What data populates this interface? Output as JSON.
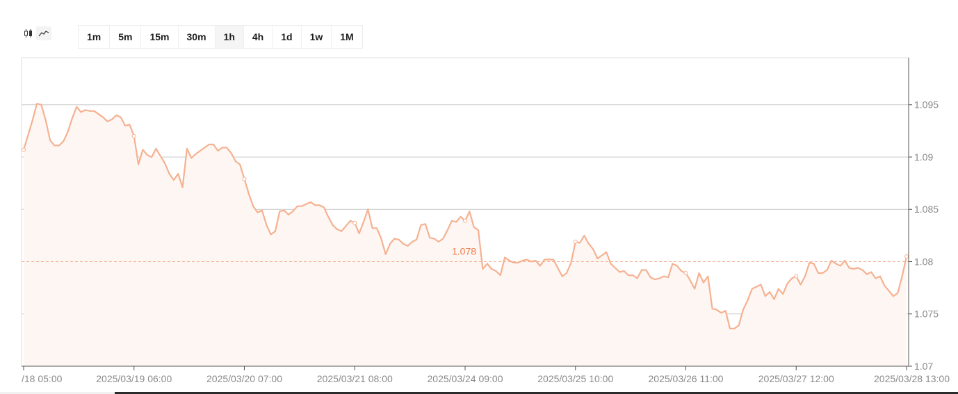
{
  "toolbar": {
    "chart_types": [
      {
        "icon": "candlestick-icon",
        "active": false
      },
      {
        "icon": "line-chart-icon",
        "active": true
      }
    ],
    "intervals": [
      "1m",
      "5m",
      "15m",
      "30m",
      "1h",
      "4h",
      "1d",
      "1w",
      "1M"
    ],
    "active_interval": "1h"
  },
  "chart_data": {
    "type": "area",
    "title": "",
    "xlabel": "",
    "ylabel": "",
    "ylim": [
      1.07,
      1.0995
    ],
    "y_ticks": [
      "1.07",
      "1.075",
      "1.08",
      "1.085",
      "1.09",
      "1.095"
    ],
    "x_ticks": [
      "/18 05:00",
      "2025/03/19 06:00",
      "2025/03/20 07:00",
      "2025/03/21 08:00",
      "2025/03/24 09:00",
      "2025/03/25 10:00",
      "2025/03/26 11:00",
      "2025/03/27 12:00",
      "2025/03/28 13:00"
    ],
    "reference_line": {
      "value": 1.08,
      "label": "1.078"
    },
    "line_color": "#f5b191",
    "fill_color": "#fef6f2",
    "grid": true,
    "series": [
      {
        "values": [
          1.0907,
          1.0921,
          1.0935,
          1.0951,
          1.095,
          1.0935,
          1.0916,
          1.0911,
          1.0911,
          1.0915,
          1.0924,
          1.0937,
          1.0948,
          1.0943,
          1.0945,
          1.0944,
          1.0944,
          1.0941,
          1.0938,
          1.0934,
          1.0936,
          1.094,
          1.0938,
          1.093,
          1.0931,
          1.092,
          1.0893,
          1.0907,
          1.0902,
          1.09,
          1.0908,
          1.0901,
          1.0894,
          1.0884,
          1.0878,
          1.0884,
          1.0871,
          1.0908,
          1.0899,
          1.0903,
          1.0906,
          1.0909,
          1.0912,
          1.0912,
          1.0906,
          1.0909,
          1.0909,
          1.0904,
          1.0896,
          1.0893,
          1.0879,
          1.0865,
          1.0853,
          1.0847,
          1.0849,
          1.0835,
          1.0826,
          1.0829,
          1.0848,
          1.0849,
          1.0845,
          1.0848,
          1.0853,
          1.0853,
          1.0855,
          1.0857,
          1.0854,
          1.0854,
          1.0852,
          1.0843,
          1.0835,
          1.0831,
          1.0829,
          1.0834,
          1.0839,
          1.0837,
          1.0827,
          1.0838,
          1.085,
          1.0832,
          1.0832,
          1.0822,
          1.0807,
          1.0817,
          1.0822,
          1.0821,
          1.0817,
          1.0815,
          1.0819,
          1.0821,
          1.0835,
          1.0836,
          1.0823,
          1.0822,
          1.0819,
          1.0822,
          1.083,
          1.0839,
          1.0838,
          1.0843,
          1.0839,
          1.0848,
          1.0833,
          1.083,
          1.0793,
          1.0798,
          1.0793,
          1.0791,
          1.0787,
          1.0804,
          1.0801,
          1.0799,
          1.0799,
          1.0801,
          1.0802,
          1.08,
          1.0801,
          1.0796,
          1.0802,
          1.0802,
          1.0802,
          1.0794,
          1.0786,
          1.0789,
          1.0799,
          1.0819,
          1.0818,
          1.0825,
          1.0817,
          1.0812,
          1.0803,
          1.0806,
          1.0809,
          1.0798,
          1.0794,
          1.079,
          1.0791,
          1.0787,
          1.0787,
          1.0784,
          1.0792,
          1.0792,
          1.0785,
          1.0783,
          1.0784,
          1.0786,
          1.0785,
          1.0798,
          1.0796,
          1.0791,
          1.0789,
          1.0782,
          1.0774,
          1.0789,
          1.078,
          1.0786,
          1.0755,
          1.0754,
          1.0751,
          1.0753,
          1.0736,
          1.0736,
          1.0739,
          1.0754,
          1.0763,
          1.0774,
          1.0776,
          1.0778,
          1.0767,
          1.0771,
          1.0764,
          1.0774,
          1.0769,
          1.0779,
          1.0784,
          1.0786,
          1.0778,
          1.0786,
          1.0799,
          1.0798,
          1.0789,
          1.0789,
          1.0792,
          1.0801,
          1.0798,
          1.0796,
          1.0801,
          1.0794,
          1.0793,
          1.0794,
          1.0792,
          1.0788,
          1.079,
          1.0784,
          1.0786,
          1.0777,
          1.0772,
          1.0767,
          1.077,
          1.0786,
          1.0805
        ]
      }
    ]
  }
}
